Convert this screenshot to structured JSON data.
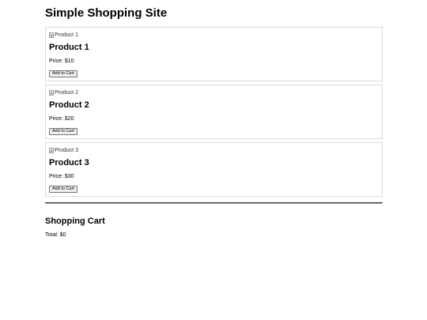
{
  "header": {
    "title": "Simple Shopping Site"
  },
  "products": [
    {
      "image_alt": "Product 1",
      "name": "Product 1",
      "price": "Price: $10",
      "button_label": "Add to Cart"
    },
    {
      "image_alt": "Product 2",
      "name": "Product 2",
      "price": "Price: $20",
      "button_label": "Add to Cart"
    },
    {
      "image_alt": "Product 3",
      "name": "Product 3",
      "price": "Price: $30",
      "button_label": "Add to Cart"
    }
  ],
  "cart": {
    "title": "Shopping Cart",
    "total": "Total: $0"
  },
  "icons": {
    "broken_image": "broken-image-icon"
  },
  "colors": {
    "background": "#ffffff",
    "card_border": "#dcdcdc",
    "button_background": "#efefef",
    "button_border": "#767676",
    "divider": "#3a3a3a"
  }
}
